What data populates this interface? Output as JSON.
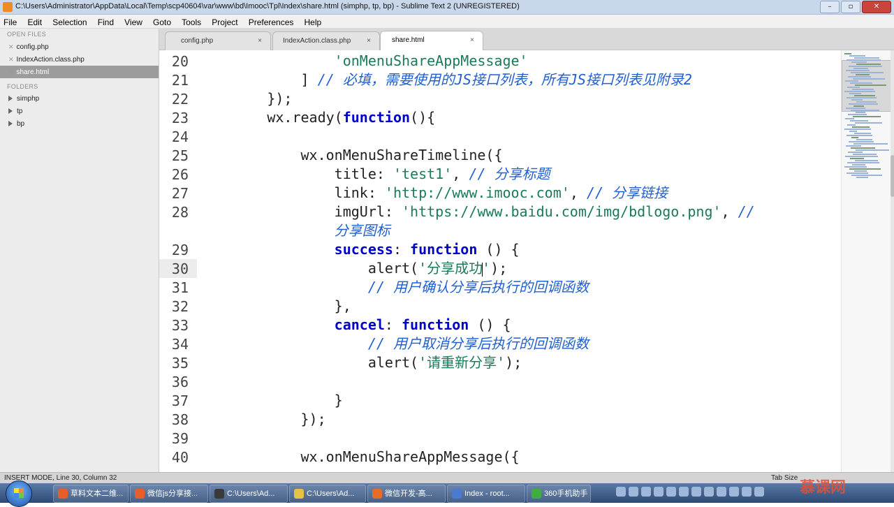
{
  "window": {
    "title": "C:\\Users\\Administrator\\AppData\\Local\\Temp\\scp40604\\var\\www\\bd\\Imooc\\Tpl\\Index\\share.html (simphp, tp, bp) - Sublime Text 2 (UNREGISTERED)",
    "buttons": [
      "–",
      "▫",
      "✕"
    ]
  },
  "menu": [
    "File",
    "Edit",
    "Selection",
    "Find",
    "View",
    "Goto",
    "Tools",
    "Project",
    "Preferences",
    "Help"
  ],
  "sidebar": {
    "open_files_header": "OPEN FILES",
    "open_files": [
      "config.php",
      "IndexAction.class.php",
      "share.html"
    ],
    "folders_header": "FOLDERS",
    "folders": [
      "simphp",
      "tp",
      "bp"
    ],
    "close_glyph": "✕"
  },
  "tabs": [
    {
      "label": "config.php",
      "close": "×"
    },
    {
      "label": "IndexAction.class.php",
      "close": "×"
    },
    {
      "label": "share.html",
      "close": "×"
    }
  ],
  "editor": {
    "line_numbers": [
      "20",
      "21",
      "22",
      "23",
      "24",
      "25",
      "26",
      "27",
      "28",
      "",
      "29",
      "30",
      "31",
      "32",
      "33",
      "34",
      "35",
      "36",
      "37",
      "38",
      "39",
      "40"
    ],
    "lines": [
      [
        {
          "t": "'onMenuShareAppMessage'",
          "c": "str",
          "indent": "                "
        }
      ],
      [
        {
          "t": "] ",
          "c": "",
          "indent": "            "
        },
        {
          "t": "// 必填，需要使用的JS接口列表，所有JS接口列表见附录2",
          "c": "cm"
        }
      ],
      [
        {
          "t": "});",
          "c": "",
          "indent": "        "
        }
      ],
      [
        {
          "t": "wx.ready(",
          "c": "",
          "indent": "        "
        },
        {
          "t": "function",
          "c": "kw"
        },
        {
          "t": "(){",
          "c": ""
        }
      ],
      [],
      [
        {
          "t": "wx.onMenuShareTimeline({",
          "c": "",
          "indent": "            "
        }
      ],
      [
        {
          "t": "title: ",
          "c": "",
          "indent": "                "
        },
        {
          "t": "'test1'",
          "c": "str"
        },
        {
          "t": ", ",
          "c": ""
        },
        {
          "t": "// 分享标题",
          "c": "cm"
        }
      ],
      [
        {
          "t": "link: ",
          "c": "",
          "indent": "                "
        },
        {
          "t": "'http://www.imooc.com'",
          "c": "str"
        },
        {
          "t": ", ",
          "c": ""
        },
        {
          "t": "// 分享链接",
          "c": "cm"
        }
      ],
      [
        {
          "t": "imgUrl: ",
          "c": "",
          "indent": "                "
        },
        {
          "t": "'https://www.baidu.com/img/bdlogo.png'",
          "c": "str"
        },
        {
          "t": ", ",
          "c": ""
        },
        {
          "t": "//",
          "c": "cm"
        }
      ],
      [
        {
          "t": "分享图标",
          "c": "cm",
          "indent": "                "
        }
      ],
      [
        {
          "t": "success",
          "c": "kw",
          "indent": "                "
        },
        {
          "t": ": ",
          "c": ""
        },
        {
          "t": "function",
          "c": "kw"
        },
        {
          "t": " () {",
          "c": ""
        }
      ],
      [
        {
          "t": "alert(",
          "c": "",
          "indent": "                    "
        },
        {
          "t": "'分享成功",
          "c": "str"
        },
        {
          "t": "|",
          "c": "cursor"
        },
        {
          "t": "'",
          "c": "str"
        },
        {
          "t": ");",
          "c": ""
        }
      ],
      [
        {
          "t": "// 用户确认分享后执行的回调函数",
          "c": "cm",
          "indent": "                    "
        }
      ],
      [
        {
          "t": "},",
          "c": "",
          "indent": "                "
        }
      ],
      [
        {
          "t": "cancel",
          "c": "kw",
          "indent": "                "
        },
        {
          "t": ": ",
          "c": ""
        },
        {
          "t": "function",
          "c": "kw"
        },
        {
          "t": " () {",
          "c": ""
        }
      ],
      [
        {
          "t": "// 用户取消分享后执行的回调函数",
          "c": "cm",
          "indent": "                    "
        }
      ],
      [
        {
          "t": "alert(",
          "c": "",
          "indent": "                    "
        },
        {
          "t": "'请重新分享'",
          "c": "str"
        },
        {
          "t": ");",
          "c": ""
        }
      ],
      [],
      [
        {
          "t": "}",
          "c": "",
          "indent": "                "
        }
      ],
      [
        {
          "t": "});",
          "c": "",
          "indent": "            "
        }
      ],
      [],
      [
        {
          "t": "wx.onMenuShareAppMessage({",
          "c": "",
          "indent": "            "
        }
      ]
    ],
    "current_line_index": 11
  },
  "status": {
    "left": "INSERT MODE, Line 30, Column 32",
    "right": "Tab Size"
  },
  "taskbar": {
    "items": [
      {
        "label": "草料文本二维...",
        "color": "#e85d2a"
      },
      {
        "label": "微信js分享接...",
        "color": "#e85d2a"
      },
      {
        "label": "C:\\Users\\Ad...",
        "color": "#3a3a3a"
      },
      {
        "label": "C:\\Users\\Ad...",
        "color": "#e8c045"
      },
      {
        "label": "微信开发-高...",
        "color": "#e86b2a"
      },
      {
        "label": "Index - root...",
        "color": "#4a7bd0"
      },
      {
        "label": "360手机助手",
        "color": "#3fae3f"
      }
    ]
  },
  "watermark": "慕课网"
}
